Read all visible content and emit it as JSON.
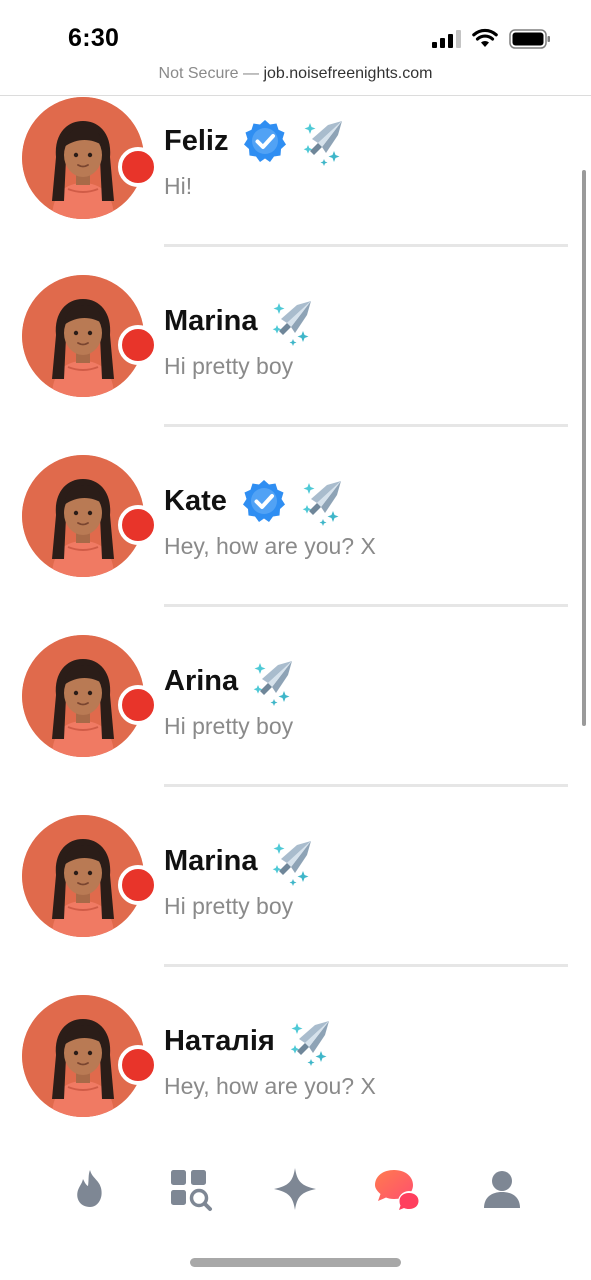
{
  "status_bar": {
    "time": "6:30"
  },
  "url_bar": {
    "security_label": "Not Secure — ",
    "host": "job.noisefreenights.com"
  },
  "chats": [
    {
      "name": "Feliz",
      "message": "Hi!",
      "verified": true
    },
    {
      "name": "Marina",
      "message": "Hi pretty boy",
      "verified": false
    },
    {
      "name": "Kate",
      "message": "Hey, how are you? X",
      "verified": true
    },
    {
      "name": "Arina",
      "message": "Hi pretty boy",
      "verified": false
    },
    {
      "name": "Marina",
      "message": "Hi pretty boy",
      "verified": false
    },
    {
      "name": "Наталія",
      "message": "Hey, how are you? X",
      "verified": false
    }
  ],
  "icons": {
    "avatar": "female-avatar-icon",
    "online": "online-status-dot",
    "verified": "verified-badge-icon",
    "boost": "jet-boost-icon"
  },
  "bottom_nav": [
    {
      "icon": "flame-icon",
      "active": false
    },
    {
      "icon": "explore-grid-icon",
      "active": false
    },
    {
      "icon": "sparkle-icon",
      "active": false
    },
    {
      "icon": "chat-bubbles-icon",
      "active": true
    },
    {
      "icon": "profile-icon",
      "active": false
    }
  ],
  "colors": {
    "avatar_bg": "#e06a4c",
    "online_dot": "#e8342a",
    "verified_blue": "#2f8ef2",
    "nav_inactive": "#7e8794",
    "nav_active": "#ff5a4f",
    "message_gray": "#8a8a8a"
  }
}
